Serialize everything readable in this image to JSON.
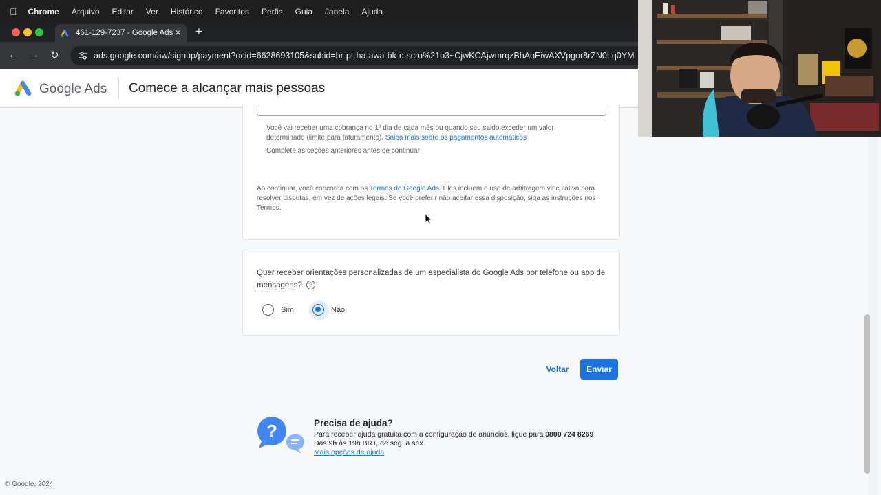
{
  "menubar": {
    "apple_icon": "apple-icon",
    "items": [
      "Chrome",
      "Arquivo",
      "Editar",
      "Ver",
      "Histórico",
      "Favoritos",
      "Perfis",
      "Guia",
      "Janela",
      "Ajuda"
    ]
  },
  "browser": {
    "tab_title": "461-129-7237 - Google Ads",
    "url": "ads.google.com/aw/signup/payment?ocid=6628693105&subid=br-pt-ha-awa-bk-c-scru%21o3~CjwKCAjwmrqzBhAoEiwAXVpgor8rZN0Lq0YM"
  },
  "header": {
    "brand": "Google Ads",
    "page_title": "Comece a alcançar mais pessoas"
  },
  "billing": {
    "text": "Você vai receber uma cobrança no 1º dia de cada mês ou quando seu saldo exceder um valor determinado (limite para faturamento).",
    "link": "Saiba mais sobre os pagamentos automáticos",
    "note": "Complete as seções anteriores antes de continuar"
  },
  "terms": {
    "prefix": "Ao continuar, você concorda com os",
    "link": "Termos do Google Ads",
    "suffix": ". Eles incluem o uso de arbitragem vinculativa para resolver disputas, em vez de ações legais. Se você preferir não aceitar essa disposição, siga as instruções nos Termos."
  },
  "consultation": {
    "question": "Quer receber orientações personalizadas de um especialista do Google Ads por telefone ou app de mensagens?",
    "options": [
      {
        "label": "Sim",
        "selected": false
      },
      {
        "label": "Não",
        "selected": true
      }
    ]
  },
  "actions": {
    "back": "Voltar",
    "submit": "Enviar"
  },
  "help": {
    "title": "Precisa de ajuda?",
    "line1": "Para receber ajuda gratuita com a configuração de anúncios, ligue para",
    "phone": "0800 724 8269",
    "line2": "Das 9h às 19h BRT, de seg. a sex.",
    "link": "Mais opções de ajuda"
  },
  "footer": {
    "copyright": "© Google, 2024."
  },
  "colors": {
    "accent": "#1a73e8",
    "chrome_dark": "#202124"
  }
}
